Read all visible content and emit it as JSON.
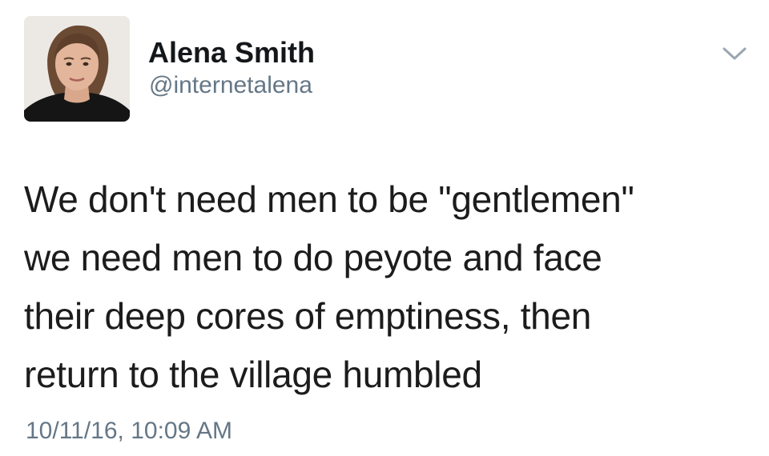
{
  "tweet": {
    "author": {
      "name": "Alena Smith",
      "handle": "@internetalena"
    },
    "text_lines": [
      "We don't need men to be \"gentlemen\"",
      "we need men to do peyote and face",
      "their deep cores of emptiness, then",
      "return to the village humbled"
    ],
    "timestamp": "10/11/16, 10:09 AM",
    "icons": {
      "menu": "chevron-down-icon",
      "avatar": "profile-photo"
    },
    "colors": {
      "name": "#14171a",
      "secondary": "#657786",
      "background": "#ffffff"
    }
  }
}
